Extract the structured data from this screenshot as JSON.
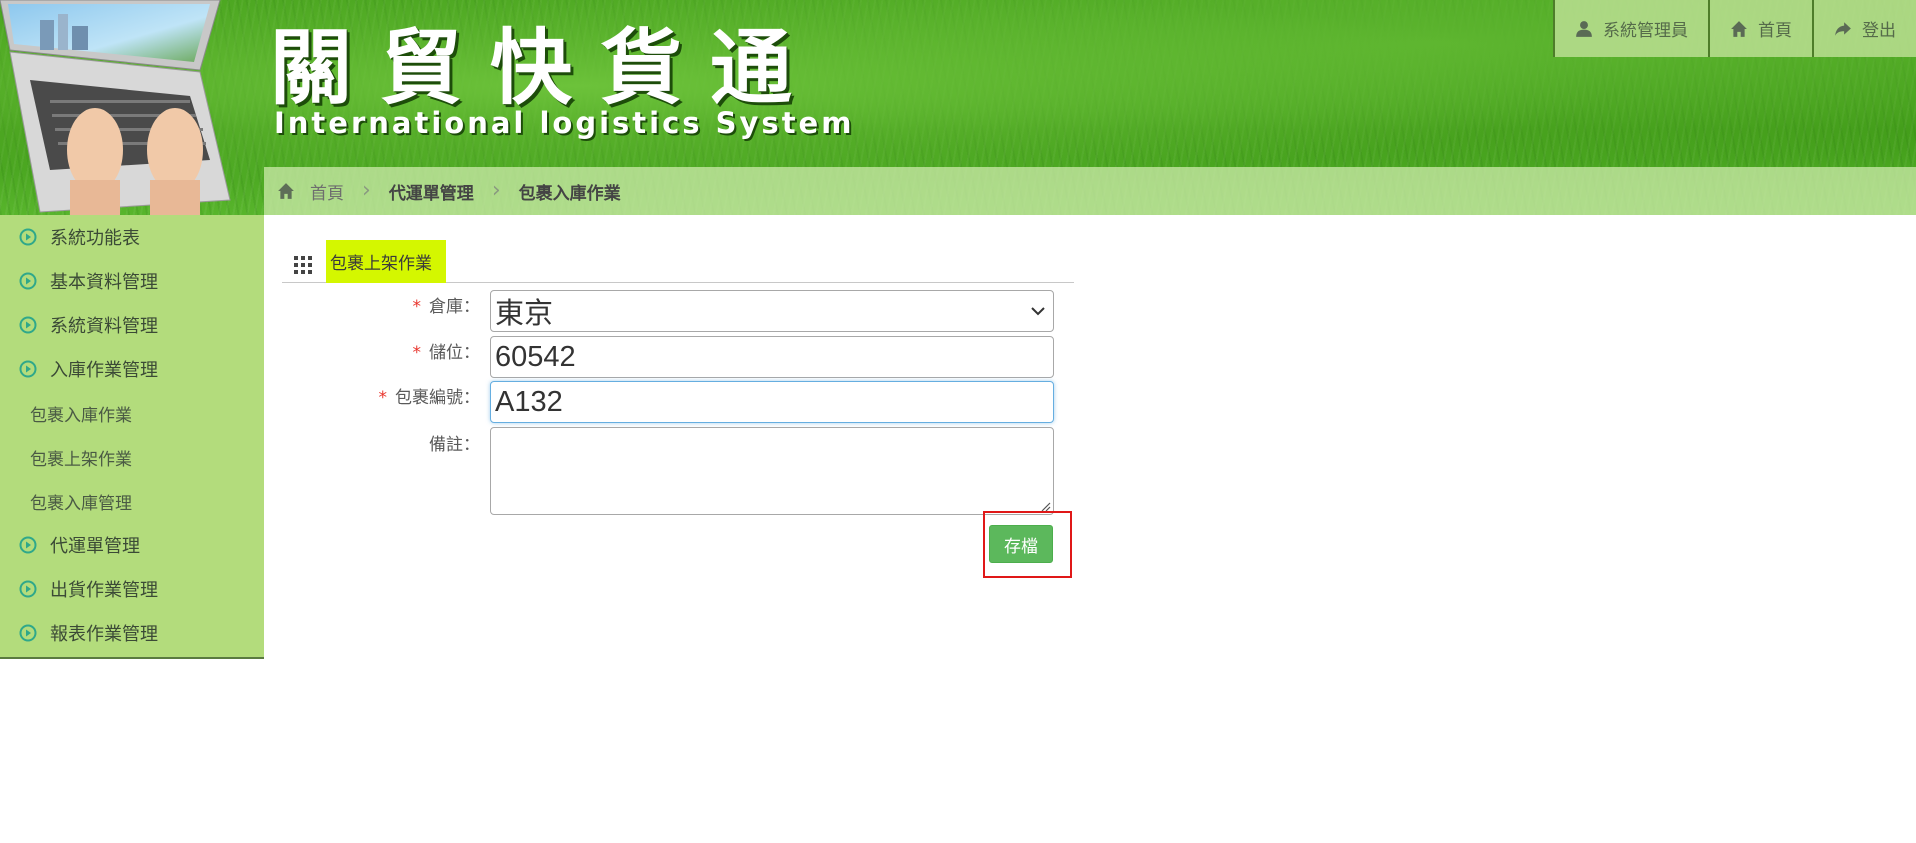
{
  "header": {
    "logo_cn": "關貿快貨通",
    "logo_en": "International logistics System",
    "top_links": [
      {
        "label": "系統管理員",
        "icon": "user-icon"
      },
      {
        "label": "首頁",
        "icon": "home-icon"
      },
      {
        "label": "登出",
        "icon": "share-arrow-icon"
      }
    ]
  },
  "breadcrumb": {
    "home": "首頁",
    "level1": "代運單管理",
    "level2": "包裹入庫作業"
  },
  "sidebar": {
    "items": [
      {
        "label": "系統功能表",
        "type": "main"
      },
      {
        "label": "基本資料管理",
        "type": "main"
      },
      {
        "label": "系統資料管理",
        "type": "main"
      },
      {
        "label": "入庫作業管理",
        "type": "main"
      },
      {
        "label": "包裹入庫作業",
        "type": "sub"
      },
      {
        "label": "包裹上架作業",
        "type": "sub"
      },
      {
        "label": "包裹入庫管理",
        "type": "sub"
      },
      {
        "label": "代運單管理",
        "type": "main"
      },
      {
        "label": "出貨作業管理",
        "type": "main"
      },
      {
        "label": "報表作業管理",
        "type": "main"
      }
    ]
  },
  "form": {
    "section_title": "包裹上架作業",
    "required_mark": "*",
    "warehouse_label": "倉庫：",
    "warehouse_value": "東京",
    "location_label": "儲位：",
    "location_value": "60542",
    "package_label": "包裹編號：",
    "package_value": "A132",
    "remark_label": "備註：",
    "remark_value": "",
    "save_label": "存檔"
  },
  "colors": {
    "sidebar_bg": "#b3dc7c",
    "section_highlight": "#d4f700",
    "save_button": "#5cb85c",
    "highlight_border": "#e01818"
  }
}
